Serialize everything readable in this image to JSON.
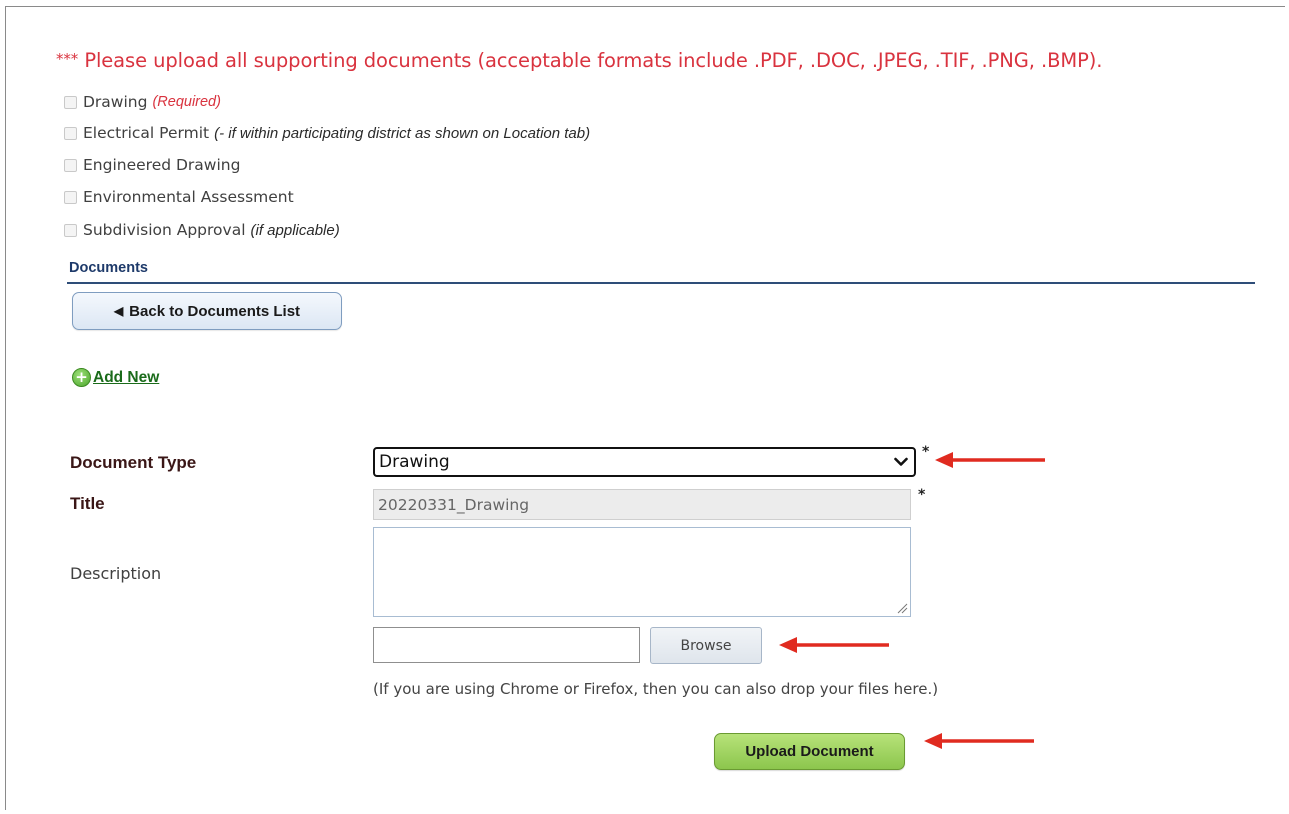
{
  "notice": {
    "stars": "***",
    "text": "Please upload all supporting documents (acceptable formats include .PDF, .DOC, .JPEG, .TIF, .PNG, .BMP)."
  },
  "checklist": [
    {
      "label": "Drawing",
      "note": "(Required)",
      "note_color": "#d9333f"
    },
    {
      "label": "Electrical Permit",
      "note": "(- if within participating district as shown on Location tab)",
      "note_color": "#2a2a2a"
    },
    {
      "label": "Engineered Drawing",
      "note": ""
    },
    {
      "label": "Environmental Assessment",
      "note": ""
    },
    {
      "label": "Subdivision Approval",
      "note": "(if applicable)",
      "note_color": "#2a2a2a"
    }
  ],
  "section": {
    "title": "Documents"
  },
  "back_button": {
    "label": "Back to Documents List",
    "icon": "left-triangle-icon"
  },
  "add_new": {
    "label": "Add New",
    "icon": "green-plus-circle-icon"
  },
  "form": {
    "document_type": {
      "label": "Document Type",
      "value": "Drawing",
      "required_mark": "*"
    },
    "title": {
      "label": "Title",
      "value": "20220331_Drawing",
      "required_mark": "*"
    },
    "description": {
      "label": "Description",
      "value": ""
    },
    "file": {
      "value": "",
      "browse_label": "Browse"
    },
    "hint": "(If you are using Chrome or Firefox, then you can also drop your files here.)",
    "upload_label": "Upload Document"
  },
  "colors": {
    "notice_red": "#d9333f",
    "section_blue": "#1e3a6a",
    "upload_green": "#8cc64d",
    "annotation_arrow": "#e02b20"
  }
}
